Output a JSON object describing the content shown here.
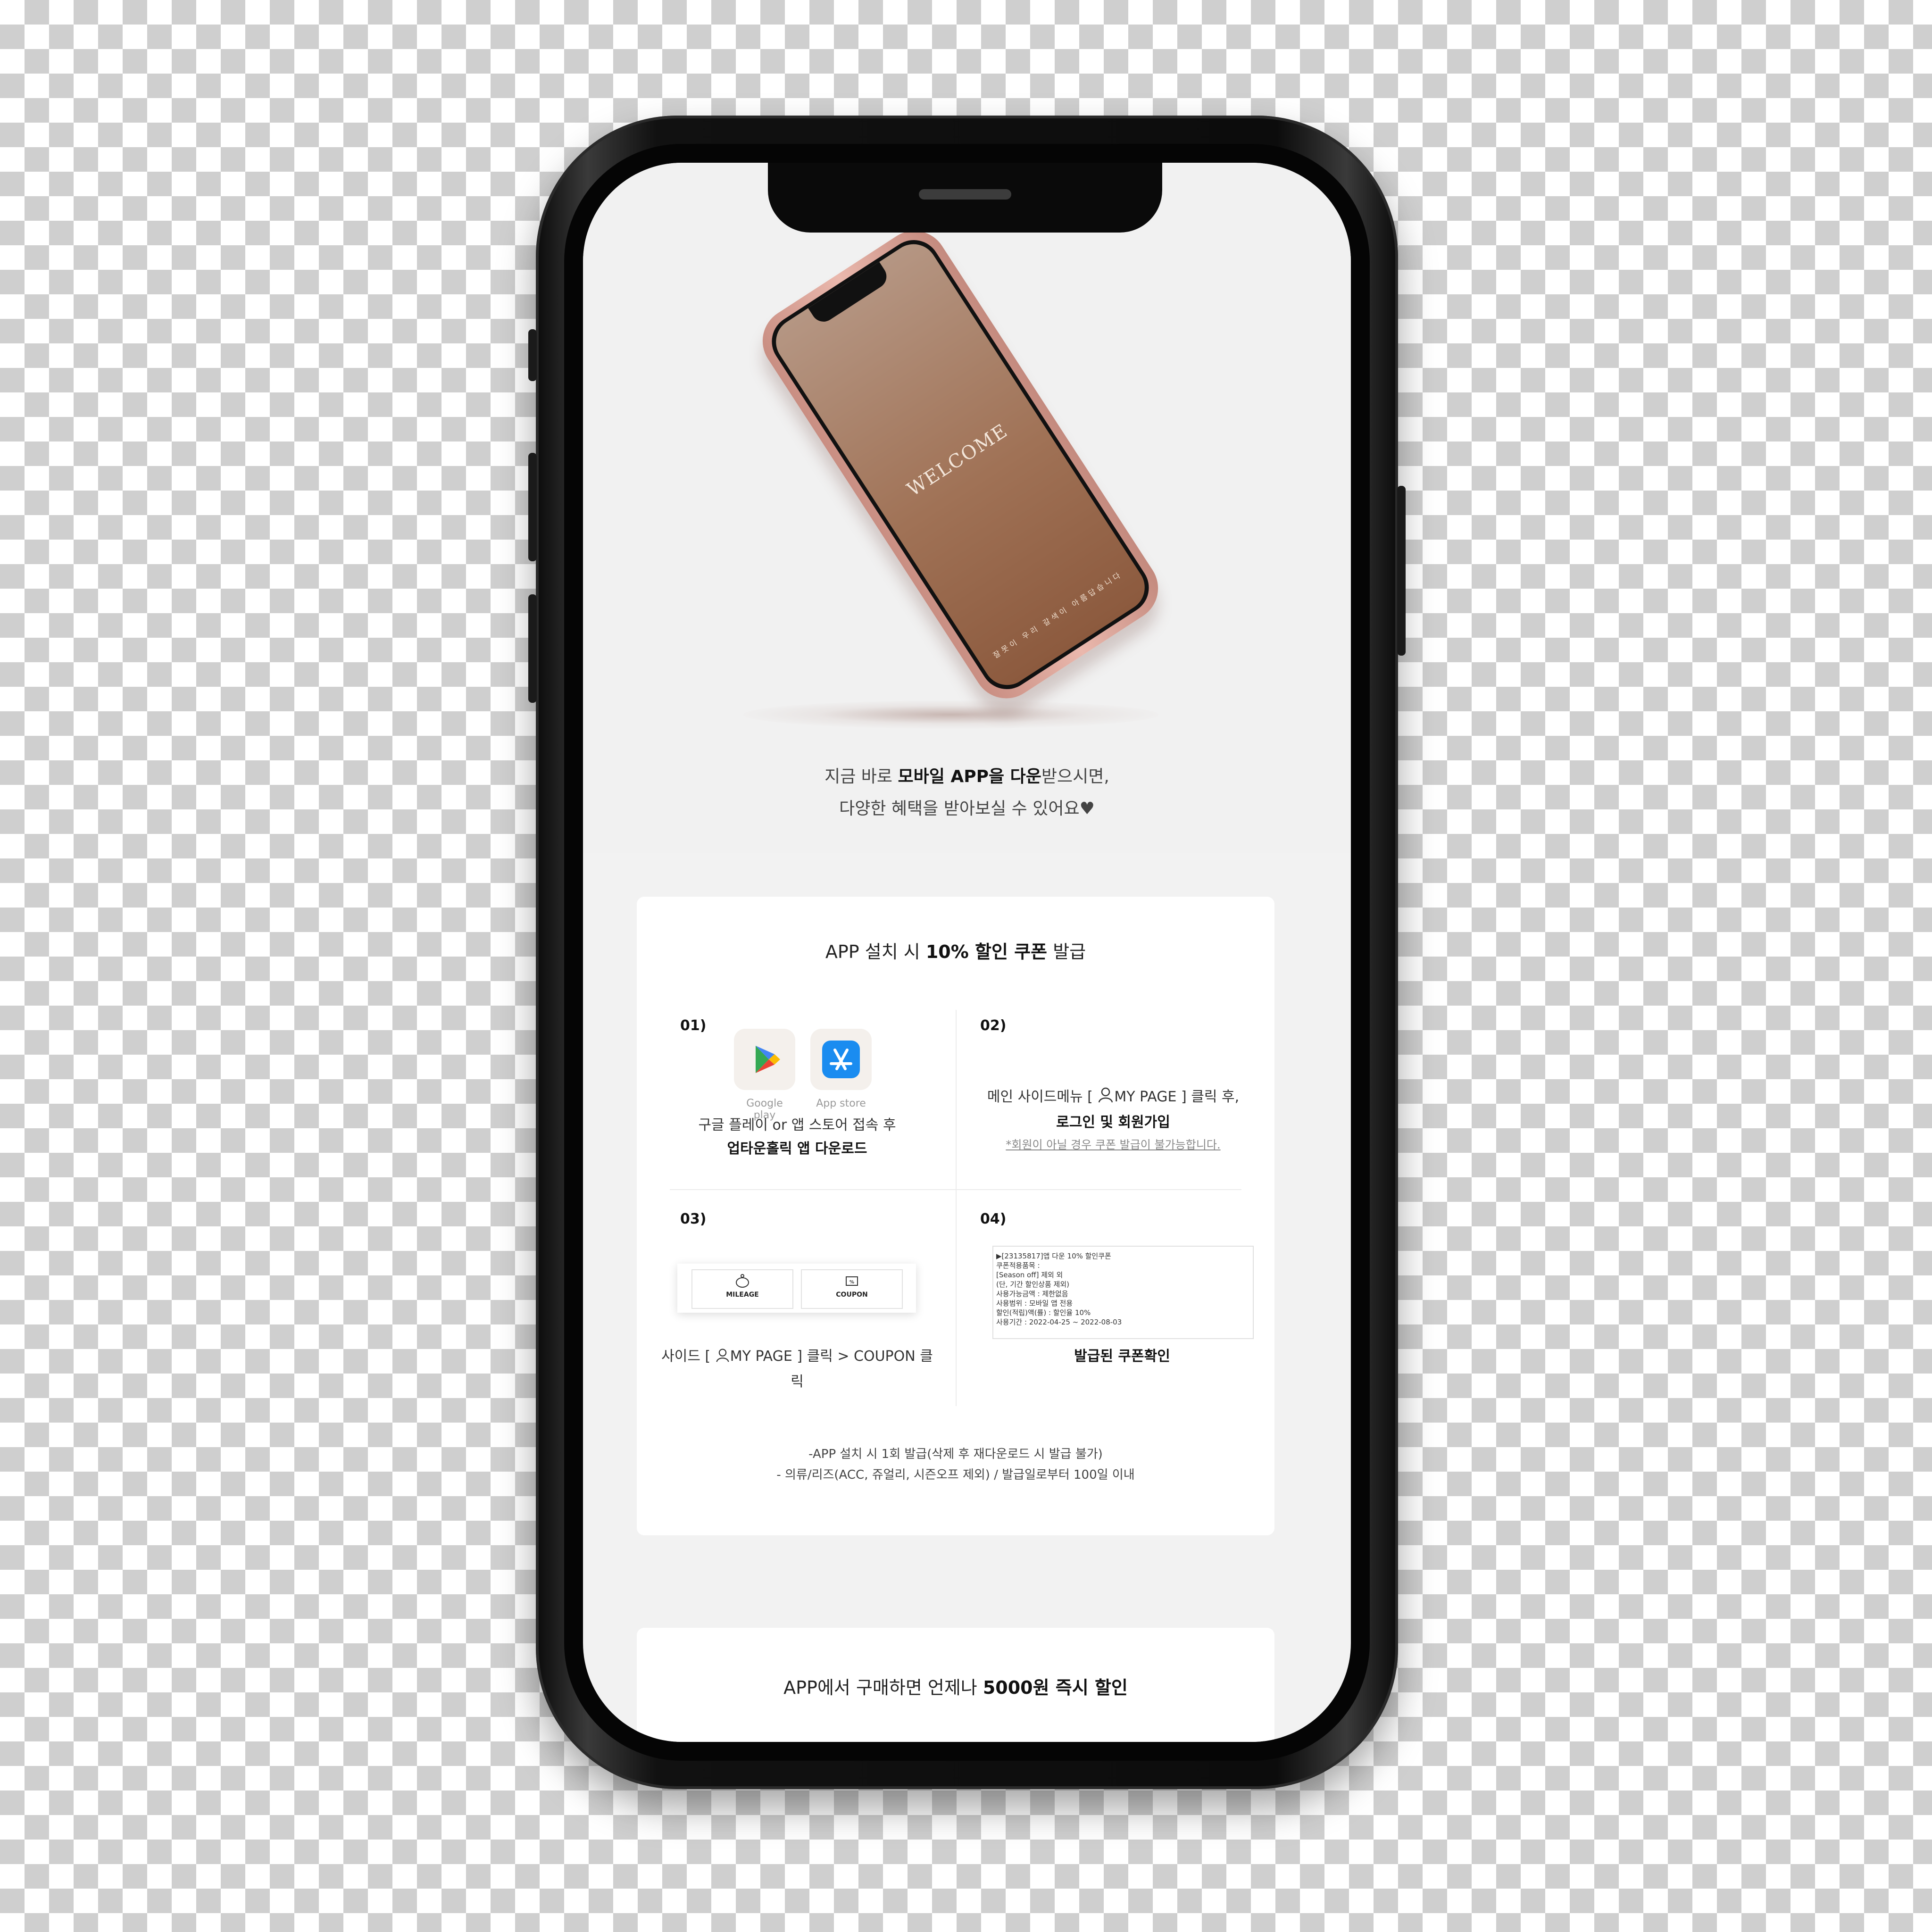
{
  "hero": {
    "welcome": "WELCOME",
    "mini_caption": "잘못이 우리 갈색이 아름답습니다",
    "line1_pre": "지금 바로 ",
    "line1_bold": "모바일 APP을 다운",
    "line1_post": "받으시면,",
    "line2": "다양한 혜택을 받아보실 수 있어요♥"
  },
  "card1": {
    "title_pre": "APP 설치 시 ",
    "title_bold": "10% 할인 쿠폰",
    "title_post": " 발급",
    "step1": {
      "num": "01)",
      "google_label": "Google play",
      "appstore_label": "App store",
      "line1": "구글 플레이 or 앱 스토어 접속 후",
      "line2": "업타운홀릭 앱 다운로드"
    },
    "step2": {
      "num": "02)",
      "line1_pre": "메인 사이드메뉴 [ ",
      "line1_post": "MY PAGE ] 클릭 후,",
      "line2": "로그인 및 회원가입",
      "note": "*회원이 아닐 경우 쿠폰 발급이 불가능합니다."
    },
    "step3": {
      "num": "03)",
      "tab_mileage": "MILEAGE",
      "tab_coupon": "COUPON",
      "line_pre": "사이드 [ ",
      "line_post": "MY PAGE ]  클릭 > COUPON 클릭"
    },
    "step4": {
      "num": "04)",
      "coupon_lines": [
        "▶[23135817]앱 다운 10% 할인쿠폰",
        "쿠폰적용품목 :",
        "[Season off] 제외 외",
        "(단, 기간 할인상품 제외)",
        "사용가능금액 : 제한없음",
        "사용범위 : 모바일 앱 전용",
        "할인(적립)액(률) : 할인율 10%",
        "사용기간 : 2022-04-25 ~ 2022-08-03"
      ],
      "caption": "발급된 쿠폰확인"
    },
    "notes": [
      "-APP 설치 시 1회 발급(삭제 후 재다운로드 시 발급 불가)",
      "- 의류/리즈(ACC, 쥬얼리, 시즌오프 제외) / 발급일로부터 100일 이내"
    ]
  },
  "card2": {
    "title_pre": "APP에서 구매하면 언제나 ",
    "title_bold": "5000원 즉시 할인"
  },
  "colors": {
    "screen_bg": "#f2f2f2",
    "hero_phone": "#a07256",
    "rose_gold": "#eab8ad"
  }
}
